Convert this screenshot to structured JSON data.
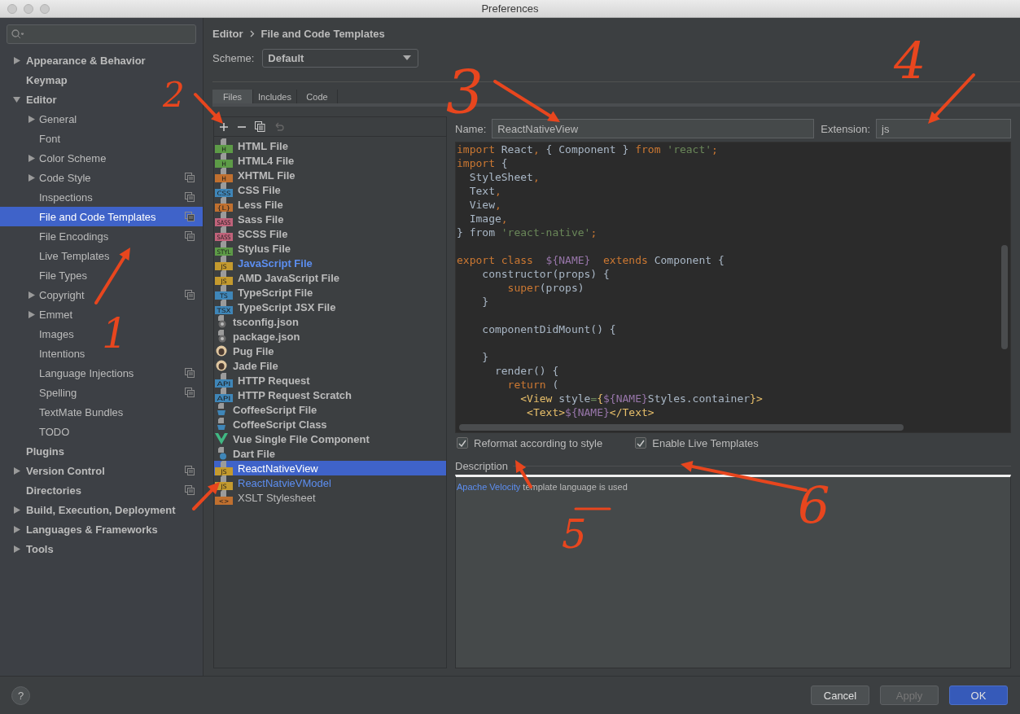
{
  "window": {
    "title": "Preferences"
  },
  "sidebar": {
    "items": [
      {
        "label": "Appearance & Behavior",
        "expanded": false,
        "selected": false,
        "scoped": false
      },
      {
        "label": "Keymap",
        "selected": false,
        "scoped": false
      },
      {
        "label": "Editor",
        "expanded": true,
        "selected": false,
        "scoped": false,
        "children": [
          {
            "label": "General",
            "expanded": false,
            "selected": false,
            "scoped": false
          },
          {
            "label": "Font",
            "selected": false,
            "scoped": false
          },
          {
            "label": "Color Scheme",
            "expanded": false,
            "selected": false,
            "scoped": false
          },
          {
            "label": "Code Style",
            "expanded": false,
            "selected": false,
            "scoped": true
          },
          {
            "label": "Inspections",
            "selected": false,
            "scoped": true
          },
          {
            "label": "File and Code Templates",
            "selected": true,
            "scoped": true
          },
          {
            "label": "File Encodings",
            "selected": false,
            "scoped": true
          },
          {
            "label": "Live Templates",
            "selected": false,
            "scoped": false
          },
          {
            "label": "File Types",
            "selected": false,
            "scoped": false
          },
          {
            "label": "Copyright",
            "expanded": false,
            "selected": false,
            "scoped": true
          },
          {
            "label": "Emmet",
            "expanded": false,
            "selected": false,
            "scoped": false
          },
          {
            "label": "Images",
            "selected": false,
            "scoped": false
          },
          {
            "label": "Intentions",
            "selected": false,
            "scoped": false
          },
          {
            "label": "Language Injections",
            "selected": false,
            "scoped": true
          },
          {
            "label": "Spelling",
            "selected": false,
            "scoped": true
          },
          {
            "label": "TextMate Bundles",
            "selected": false,
            "scoped": false
          },
          {
            "label": "TODO",
            "selected": false,
            "scoped": false
          }
        ]
      },
      {
        "label": "Plugins",
        "selected": false,
        "scoped": false
      },
      {
        "label": "Version Control",
        "expanded": false,
        "selected": false,
        "scoped": true
      },
      {
        "label": "Directories",
        "selected": false,
        "scoped": true
      },
      {
        "label": "Build, Execution, Deployment",
        "expanded": false,
        "selected": false,
        "scoped": false
      },
      {
        "label": "Languages & Frameworks",
        "expanded": false,
        "selected": false,
        "scoped": false
      },
      {
        "label": "Tools",
        "expanded": false,
        "selected": false,
        "scoped": false
      }
    ]
  },
  "breadcrumb": [
    "Editor",
    "File and Code Templates"
  ],
  "scheme": {
    "label": "Scheme:",
    "value": "Default"
  },
  "tabs": [
    {
      "label": "Files",
      "selected": true
    },
    {
      "label": "Includes",
      "selected": false
    },
    {
      "label": "Code",
      "selected": false
    }
  ],
  "templates": [
    {
      "label": "HTML File",
      "kind": "badge",
      "badge": "H",
      "color": "#5d9b47",
      "bold": true,
      "modified": false,
      "selected": false
    },
    {
      "label": "HTML4 File",
      "kind": "badge",
      "badge": "H",
      "color": "#5d9b47",
      "bold": true,
      "modified": false,
      "selected": false
    },
    {
      "label": "XHTML File",
      "kind": "badge",
      "badge": "H",
      "color": "#c0702f",
      "bold": true,
      "modified": false,
      "selected": false
    },
    {
      "label": "CSS File",
      "kind": "badge",
      "badge": "CSS",
      "color": "#3f86b8",
      "bold": true,
      "modified": false,
      "selected": false
    },
    {
      "label": "Less File",
      "kind": "badge",
      "badge": "{L}",
      "color": "#c0702f",
      "bold": true,
      "modified": false,
      "selected": false
    },
    {
      "label": "Sass File",
      "kind": "badge",
      "badge": "SASS",
      "color": "#c0627a",
      "bold": true,
      "modified": false,
      "selected": false
    },
    {
      "label": "SCSS File",
      "kind": "badge",
      "badge": "SASS",
      "color": "#c0627a",
      "bold": true,
      "modified": false,
      "selected": false
    },
    {
      "label": "Stylus File",
      "kind": "badge",
      "badge": "STYL",
      "color": "#5d9b47",
      "bold": true,
      "modified": false,
      "selected": false
    },
    {
      "label": "JavaScript File",
      "kind": "badge",
      "badge": "JS",
      "color": "#c49a2e",
      "bold": true,
      "modified": true,
      "selected": false
    },
    {
      "label": "AMD JavaScript File",
      "kind": "badge",
      "badge": "JS",
      "color": "#c49a2e",
      "bold": true,
      "modified": false,
      "selected": false
    },
    {
      "label": "TypeScript File",
      "kind": "badge",
      "badge": "TS",
      "color": "#3f86b8",
      "bold": true,
      "modified": false,
      "selected": false
    },
    {
      "label": "TypeScript JSX File",
      "kind": "badge",
      "badge": "TSX",
      "color": "#3f86b8",
      "bold": true,
      "modified": false,
      "selected": false
    },
    {
      "label": "tsconfig.json",
      "kind": "json",
      "bold": true,
      "modified": false,
      "selected": false
    },
    {
      "label": "package.json",
      "kind": "json",
      "bold": true,
      "modified": false,
      "selected": false
    },
    {
      "label": "Pug File",
      "kind": "pug",
      "bold": true,
      "modified": false,
      "selected": false
    },
    {
      "label": "Jade File",
      "kind": "pug",
      "bold": true,
      "modified": false,
      "selected": false
    },
    {
      "label": "HTTP Request",
      "kind": "badge",
      "badge": "API",
      "color": "#3f86b8",
      "bold": true,
      "modified": false,
      "selected": false
    },
    {
      "label": "HTTP Request Scratch",
      "kind": "badge",
      "badge": "API",
      "color": "#3f86b8",
      "bold": true,
      "modified": false,
      "selected": false
    },
    {
      "label": "CoffeeScript File",
      "kind": "coffee",
      "bold": true,
      "modified": false,
      "selected": false
    },
    {
      "label": "CoffeeScript Class",
      "kind": "coffee",
      "bold": true,
      "modified": false,
      "selected": false
    },
    {
      "label": "Vue Single File Component",
      "kind": "vue",
      "bold": true,
      "modified": false,
      "selected": false
    },
    {
      "label": "Dart File",
      "kind": "dart",
      "bold": true,
      "modified": false,
      "selected": false
    },
    {
      "label": "ReactNativeView",
      "kind": "badge",
      "badge": "JS",
      "color": "#c49a2e",
      "bold": false,
      "modified": false,
      "selected": true
    },
    {
      "label": "ReactNatvieVModel",
      "kind": "badge",
      "badge": "JS",
      "color": "#c49a2e",
      "bold": false,
      "modified": true,
      "selected": false
    },
    {
      "label": "XSLT Stylesheet",
      "kind": "badge",
      "badge": "<>",
      "color": "#c0702f",
      "bold": false,
      "modified": false,
      "selected": false
    }
  ],
  "name_field": {
    "label": "Name:",
    "value": "ReactNativeView"
  },
  "extension_field": {
    "label": "Extension:",
    "value": "js"
  },
  "code_lines": [
    {
      "kind": "code",
      "tokens": [
        {
          "text": "import",
          "kind": "keyword"
        },
        {
          "text": " React",
          "kind": "plain"
        },
        {
          "text": ",",
          "kind": "keyword"
        },
        {
          "text": " { Component } ",
          "kind": "plain"
        },
        {
          "text": "from",
          "kind": "keyword"
        },
        {
          "text": " 'react'",
          "kind": "string"
        },
        {
          "text": ";",
          "kind": "keyword"
        }
      ]
    },
    {
      "kind": "code",
      "tokens": [
        {
          "text": "import",
          "kind": "keyword"
        },
        {
          "text": " {",
          "kind": "plain"
        }
      ]
    },
    {
      "kind": "code",
      "tokens": [
        {
          "text": "  StyleSheet",
          "kind": "plain"
        },
        {
          "text": ",",
          "kind": "keyword"
        }
      ]
    },
    {
      "kind": "code",
      "tokens": [
        {
          "text": "  Text",
          "kind": "plain"
        },
        {
          "text": ",",
          "kind": "keyword"
        }
      ]
    },
    {
      "kind": "code",
      "tokens": [
        {
          "text": "  View",
          "kind": "plain"
        },
        {
          "text": ",",
          "kind": "keyword"
        }
      ]
    },
    {
      "kind": "code",
      "tokens": [
        {
          "text": "  Image",
          "kind": "plain"
        },
        {
          "text": ",",
          "kind": "keyword"
        }
      ]
    },
    {
      "kind": "code",
      "tokens": [
        {
          "text": "} from ",
          "kind": "plain"
        },
        {
          "text": "'react-native'",
          "kind": "string"
        },
        {
          "text": ";",
          "kind": "keyword"
        }
      ]
    },
    {
      "kind": "blank"
    },
    {
      "kind": "code",
      "tokens": [
        {
          "text": "export class  ",
          "kind": "keyword"
        },
        {
          "text": "${NAME}",
          "kind": "variable"
        },
        {
          "text": "  extends",
          "kind": "keyword"
        },
        {
          "text": " Component {",
          "kind": "plain"
        }
      ]
    },
    {
      "kind": "code",
      "tokens": [
        {
          "text": "    constructor(props) {",
          "kind": "plain"
        }
      ]
    },
    {
      "kind": "code",
      "tokens": [
        {
          "text": "        super",
          "kind": "keyword"
        },
        {
          "text": "(props)",
          "kind": "plain"
        }
      ]
    },
    {
      "kind": "code",
      "tokens": [
        {
          "text": "    }",
          "kind": "plain"
        }
      ]
    },
    {
      "kind": "blank"
    },
    {
      "kind": "code",
      "tokens": [
        {
          "text": "    componentDidMount() {",
          "kind": "plain"
        }
      ]
    },
    {
      "kind": "blank"
    },
    {
      "kind": "code",
      "tokens": [
        {
          "text": "    }",
          "kind": "plain"
        }
      ]
    },
    {
      "kind": "code",
      "tokens": [
        {
          "text": "      render() {",
          "kind": "plain"
        }
      ]
    },
    {
      "kind": "code",
      "tokens": [
        {
          "text": "        return",
          "kind": "keyword"
        },
        {
          "text": " (",
          "kind": "plain"
        }
      ]
    },
    {
      "kind": "code",
      "tokens": [
        {
          "text": "          <View",
          "kind": "tag"
        },
        {
          "text": " style",
          "kind": "plain"
        },
        {
          "text": "=",
          "kind": "string"
        },
        {
          "text": "{",
          "kind": "tag"
        },
        {
          "text": "${NAME}",
          "kind": "variable"
        },
        {
          "text": "Styles.container",
          "kind": "plain"
        },
        {
          "text": "}>",
          "kind": "tag"
        }
      ]
    },
    {
      "kind": "code",
      "tokens": [
        {
          "text": "           <Text>",
          "kind": "tag"
        },
        {
          "text": "${NAME}",
          "kind": "variable"
        },
        {
          "text": "</Text>",
          "kind": "tag"
        }
      ]
    }
  ],
  "options": [
    {
      "label": "Reformat according to style",
      "checked": true
    },
    {
      "label": "Enable Live Templates",
      "checked": true
    }
  ],
  "description": {
    "title": "Description",
    "link": "Apache Velocity",
    "text": " template language is used"
  },
  "annotations": [
    "1",
    "2",
    "3",
    "4",
    "5",
    "6"
  ],
  "buttons": [
    {
      "label": "?",
      "kind": "help"
    },
    {
      "label": "Cancel",
      "kind": "normal"
    },
    {
      "label": "Apply",
      "kind": "disabled"
    },
    {
      "label": "OK",
      "kind": "default"
    }
  ]
}
